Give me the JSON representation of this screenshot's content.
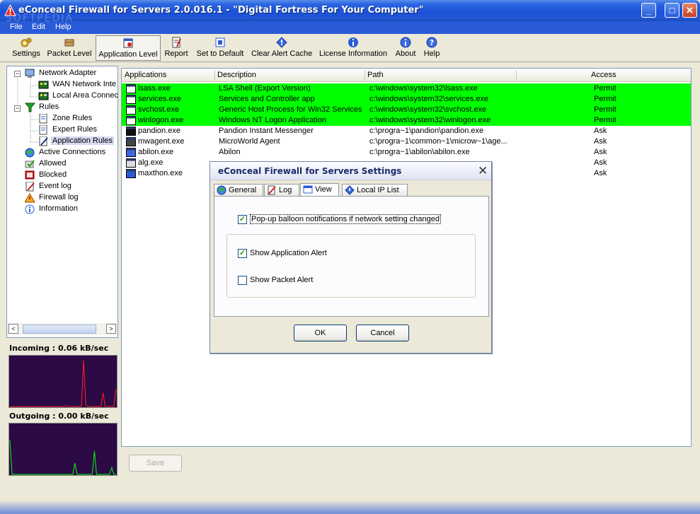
{
  "window": {
    "title": "eConceal Firewall for Servers 2.0.016.1 - \"Digital Fortress For Your Computer\"",
    "min_glyph": "_",
    "max_glyph": "□",
    "close_glyph": "✕",
    "watermark": "SOFTPEDIA"
  },
  "menu": [
    "File",
    "Edit",
    "Help"
  ],
  "toolbar": [
    {
      "label": "Settings",
      "icon": "gears-icon"
    },
    {
      "label": "Packet Level",
      "icon": "packet-icon"
    },
    {
      "label": "Application Level",
      "icon": "application-icon",
      "active": true
    },
    {
      "label": "Report",
      "icon": "report-icon"
    },
    {
      "label": "Set to Default",
      "icon": "default-icon"
    },
    {
      "label": "Clear Alert Cache",
      "icon": "clear-cache-icon"
    },
    {
      "label": "License Information",
      "icon": "license-icon"
    },
    {
      "label": "About",
      "icon": "about-icon"
    },
    {
      "label": "Help",
      "icon": "help-icon"
    }
  ],
  "tree": {
    "network_adapter": "Network Adapter",
    "wan": "WAN Network Inte",
    "lan": "Local Area Connec",
    "rules": "Rules",
    "zone_rules": "Zone Rules",
    "expert_rules": "Expert Rules",
    "application_rules": "Application Rules",
    "active_connections": "Active Connections",
    "allowed": "Allowed",
    "blocked": "Blocked",
    "event_log": "Event log",
    "firewall_log": "Firewall log",
    "information": "Information",
    "scroll_left": "<",
    "scroll_right": ">"
  },
  "traffic": {
    "incoming_label": "Incoming : 0.06 kB/sec",
    "outgoing_label": "Outgoing : 0.00 kB/sec"
  },
  "table": {
    "columns": [
      "Applications",
      "Description",
      "Path",
      "Access"
    ],
    "rows": [
      {
        "app": "lsass.exe",
        "desc": "LSA Shell (Export Version)",
        "path": "c:\\windows\\system32\\lsass.exe",
        "access": "Permit",
        "highlight": true
      },
      {
        "app": "services.exe",
        "desc": "Services and Controller app",
        "path": "c:\\windows\\system32\\services.exe",
        "access": "Permit",
        "highlight": true
      },
      {
        "app": "svchost.exe",
        "desc": "Generic Host Process for Win32 Services",
        "path": "c:\\windows\\system32\\svchost.exe",
        "access": "Permit",
        "highlight": true
      },
      {
        "app": "winlogon.exe",
        "desc": "Windows NT Logon Application",
        "path": "c:\\windows\\system32\\winlogon.exe",
        "access": "Permit",
        "highlight": true
      },
      {
        "app": "pandion.exe",
        "desc": "Pandion Instant Messenger",
        "path": "c:\\progra~1\\pandion\\pandion.exe",
        "access": "Ask",
        "highlight": false
      },
      {
        "app": "mwagent.exe",
        "desc": "MicroWorld Agent",
        "path": "c:\\progra~1\\common~1\\microw~1\\age...",
        "access": "Ask",
        "highlight": false
      },
      {
        "app": "abilon.exe",
        "desc": "Abilon",
        "path": "c:\\progra~1\\abilon\\abilon.exe",
        "access": "Ask",
        "highlight": false
      },
      {
        "app": "alg.exe",
        "desc": "",
        "path": "",
        "access": "Ask",
        "highlight": false
      },
      {
        "app": "maxthon.exe",
        "desc": "",
        "path": "",
        "access": "Ask",
        "highlight": false
      }
    ]
  },
  "save_button": "Save",
  "dialog": {
    "title": "eConceal Firewall for Servers Settings",
    "close_glyph": "✕",
    "tabs": [
      "General",
      "Log",
      "View",
      "Local IP List"
    ],
    "active_tab": "View",
    "options": [
      {
        "label": "Pop-up balloon notifications if network setting changed",
        "checked": true
      },
      {
        "label": "Show Application Alert",
        "checked": true
      },
      {
        "label": "Show Packet Alert",
        "checked": false
      }
    ],
    "ok_label": "OK",
    "cancel_label": "Cancel"
  },
  "colors": {
    "title_blue": "#2a5bd8",
    "permit_green": "#00ff00",
    "graph_bg": "#2b0a45",
    "incoming_line": "#ff2020",
    "outgoing_line": "#00ff00"
  },
  "graphs": {
    "incoming_samples": [
      0,
      0,
      0,
      0,
      0,
      0,
      0,
      0,
      0,
      0,
      0,
      0,
      0,
      0,
      0,
      0,
      0,
      0,
      0,
      0,
      0,
      0,
      0,
      0,
      0,
      0,
      2,
      0,
      0,
      0,
      0,
      0,
      0,
      0,
      95,
      4,
      0,
      0,
      0,
      0,
      0,
      0,
      0,
      28,
      0,
      0,
      0,
      0,
      0,
      36
    ],
    "outgoing_samples": [
      70,
      0,
      0,
      0,
      0,
      0,
      0,
      0,
      0,
      0,
      0,
      0,
      0,
      0,
      0,
      0,
      0,
      0,
      0,
      0,
      0,
      0,
      0,
      0,
      0,
      0,
      0,
      0,
      0,
      0,
      23,
      0,
      0,
      0,
      0,
      0,
      0,
      0,
      0,
      48,
      0,
      0,
      0,
      0,
      0,
      0,
      0,
      14,
      0,
      0
    ]
  }
}
